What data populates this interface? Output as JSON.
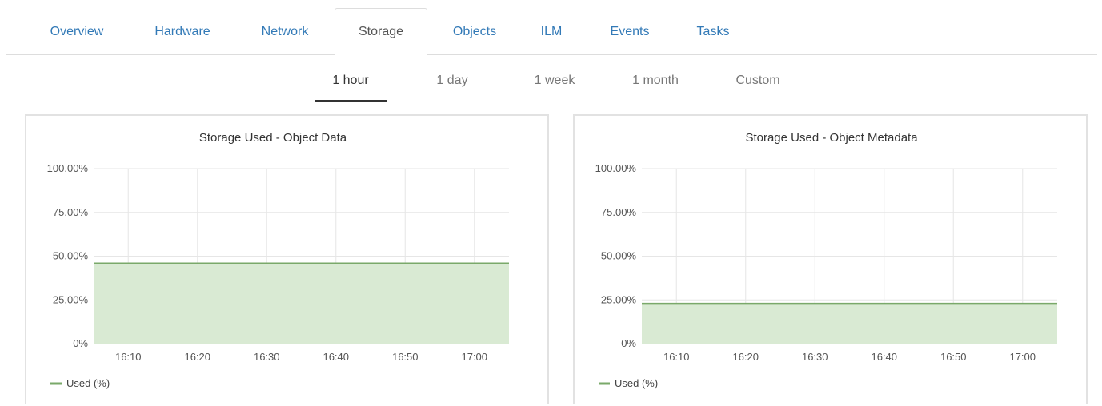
{
  "tabs": [
    {
      "label": "Overview",
      "active": false
    },
    {
      "label": "Hardware",
      "active": false
    },
    {
      "label": "Network",
      "active": false
    },
    {
      "label": "Storage",
      "active": true
    },
    {
      "label": "Objects",
      "active": false
    },
    {
      "label": "ILM",
      "active": false
    },
    {
      "label": "Events",
      "active": false
    },
    {
      "label": "Tasks",
      "active": false
    }
  ],
  "time_ranges": [
    {
      "label": "1 hour",
      "active": true
    },
    {
      "label": "1 day",
      "active": false
    },
    {
      "label": "1 week",
      "active": false
    },
    {
      "label": "1 month",
      "active": false
    },
    {
      "label": "Custom",
      "active": false
    }
  ],
  "colors": {
    "tab_link": "#337ab7",
    "series_line": "#7aa96a",
    "series_fill": "#d9ead3",
    "grid": "#e6e6e6"
  },
  "chart_data": [
    {
      "type": "area",
      "title": "Storage Used - Object Data",
      "x": [
        "16:05",
        "17:05"
      ],
      "x_ticks": [
        "16:10",
        "16:20",
        "16:30",
        "16:40",
        "16:50",
        "17:00"
      ],
      "y_ticks": [
        "0%",
        "25.00%",
        "50.00%",
        "75.00%",
        "100.00%"
      ],
      "ylim": [
        0,
        100
      ],
      "grid": true,
      "legend_position": "bottom-left",
      "series": [
        {
          "name": "Used (%)",
          "values": [
            46,
            46
          ]
        }
      ]
    },
    {
      "type": "area",
      "title": "Storage Used - Object Metadata",
      "x": [
        "16:05",
        "17:05"
      ],
      "x_ticks": [
        "16:10",
        "16:20",
        "16:30",
        "16:40",
        "16:50",
        "17:00"
      ],
      "y_ticks": [
        "0%",
        "25.00%",
        "50.00%",
        "75.00%",
        "100.00%"
      ],
      "ylim": [
        0,
        100
      ],
      "grid": true,
      "legend_position": "bottom-left",
      "series": [
        {
          "name": "Used (%)",
          "values": [
            23,
            23
          ]
        }
      ]
    }
  ]
}
